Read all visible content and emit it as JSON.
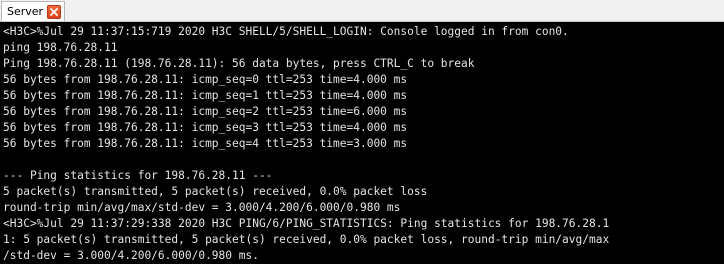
{
  "tab": {
    "label": "Server",
    "close_icon": "close-icon"
  },
  "console": {
    "lines": [
      "<H3C>%Jul 29 11:37:15:719 2020 H3C SHELL/5/SHELL_LOGIN: Console logged in from con0.",
      "ping 198.76.28.11",
      "Ping 198.76.28.11 (198.76.28.11): 56 data bytes, press CTRL_C to break",
      "56 bytes from 198.76.28.11: icmp_seq=0 ttl=253 time=4.000 ms",
      "56 bytes from 198.76.28.11: icmp_seq=1 ttl=253 time=4.000 ms",
      "56 bytes from 198.76.28.11: icmp_seq=2 ttl=253 time=6.000 ms",
      "56 bytes from 198.76.28.11: icmp_seq=3 ttl=253 time=4.000 ms",
      "56 bytes from 198.76.28.11: icmp_seq=4 ttl=253 time=3.000 ms",
      "",
      "--- Ping statistics for 198.76.28.11 ---",
      "5 packet(s) transmitted, 5 packet(s) received, 0.0% packet loss",
      "round-trip min/avg/max/std-dev = 3.000/4.200/6.000/0.980 ms",
      "<H3C>%Jul 29 11:37:29:338 2020 H3C PING/6/PING_STATISTICS: Ping statistics for 198.76.28.1",
      "1: 5 packet(s) transmitted, 5 packet(s) received, 0.0% packet loss, round-trip min/avg/max",
      "/std-dev = 3.000/4.200/6.000/0.980 ms."
    ]
  },
  "colors": {
    "console_background": "#000000",
    "console_text": "#e4e4e4",
    "close_button": "#e05a2b"
  }
}
